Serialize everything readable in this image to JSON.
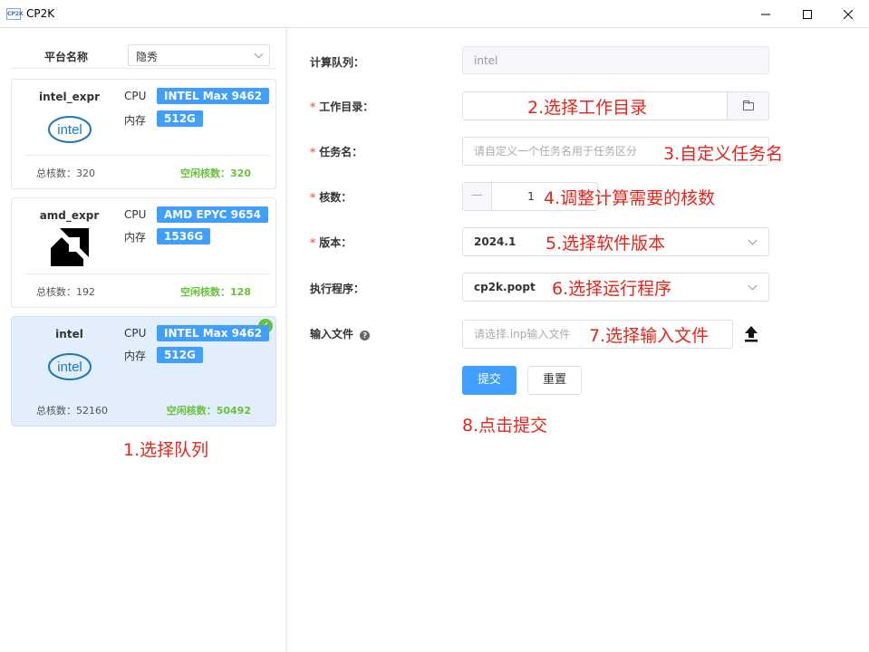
{
  "window": {
    "title": "CP2K",
    "icon_text": "CP2K"
  },
  "platform": {
    "label": "平台名称",
    "selected": "隐秀"
  },
  "cards": [
    {
      "name": "intel_expr",
      "brand": "intel",
      "cpu_label": "CPU",
      "cpu": "INTEL Max 9462",
      "mem_label": "内存",
      "mem": "512G",
      "total": "总核数：320",
      "free": "空闲核数：320",
      "selected": false
    },
    {
      "name": "amd_expr",
      "brand": "amd",
      "cpu_label": "CPU",
      "cpu": "AMD EPYC 9654",
      "mem_label": "内存",
      "mem": "1536G",
      "total": "总核数：192",
      "free": "空闲核数：128",
      "selected": false
    },
    {
      "name": "intel",
      "brand": "intel",
      "cpu_label": "CPU",
      "cpu": "INTEL Max 9462",
      "mem_label": "内存",
      "mem": "512G",
      "total": "总核数：52160",
      "free": "空闲核数：50492",
      "selected": true
    }
  ],
  "brand_text": {
    "intel": "intel"
  },
  "form": {
    "queue": {
      "label": "计算队列：",
      "value": "intel"
    },
    "workdir": {
      "label": "工作目录：",
      "value": ""
    },
    "taskname": {
      "label": "任务名：",
      "placeholder": "请自定义一个任务名用于任务区分"
    },
    "cores": {
      "label": "核数：",
      "value": "1",
      "minus": "—"
    },
    "version": {
      "label": "版本：",
      "value": "2024.1"
    },
    "program": {
      "label": "执行程序：",
      "value": "cp2k.popt"
    },
    "inputfile": {
      "label": "输入文件",
      "help": "?",
      "placeholder": "请选择.inp输入文件"
    },
    "submit": "提交",
    "reset": "重置"
  },
  "annotations": {
    "a1": "1.选择队列",
    "a2": "2.选择工作目录",
    "a3": "3.自定义任务名",
    "a4": "4.调整计算需要的核数",
    "a5": "5.选择软件版本",
    "a6": "6.选择运行程序",
    "a7": "7.选择输入文件",
    "a8": "8.点击提交"
  },
  "colors": {
    "accent": "#409eff",
    "free": "#67c23a",
    "annotation": "#e8231a",
    "selected_card": "#e2eefc"
  },
  "icons": {
    "folder": "folder-icon",
    "upload": "upload-icon",
    "help": "help-icon",
    "check": "check-icon",
    "minimize": "minimize-icon",
    "maximize": "maximize-icon",
    "close": "close-icon"
  }
}
